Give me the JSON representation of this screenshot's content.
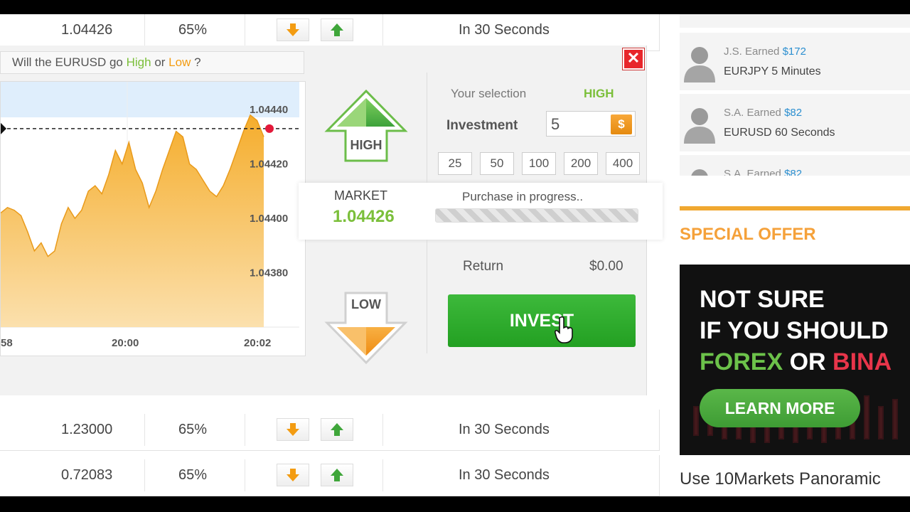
{
  "rows": {
    "top": {
      "rate": "1.04426",
      "payout": "65%",
      "expiry": "In 30 Seconds"
    },
    "row2": {
      "rate": "1.23000",
      "payout": "65%",
      "expiry": "In 30 Seconds"
    },
    "row3": {
      "rate": "0.72083",
      "payout": "65%",
      "expiry": "In 30 Seconds"
    }
  },
  "panel": {
    "question_prefix": "Will the EURUSD go",
    "question_high": "High",
    "question_or": "or",
    "question_low": "Low",
    "question_suffix": "?",
    "high_label": "HIGH",
    "low_label": "LOW",
    "market_label": "MARKET",
    "market_value": "1.04426",
    "purchase_status": "Purchase in progress..",
    "selection_label": "Your selection",
    "selection_value": "HIGH",
    "investment_label": "Investment",
    "investment_value": "5",
    "currency_symbol": "$",
    "amounts": [
      "25",
      "50",
      "100",
      "200",
      "400"
    ],
    "return_label": "Return",
    "return_value": "$0.00",
    "invest_label": "INVEST",
    "close_label": "✕"
  },
  "chart_data": {
    "type": "area",
    "x_tick_labels": [
      "58",
      "20:00",
      "20:02"
    ],
    "y_tick_labels": [
      "1.04440",
      "1.04420",
      "1.04400",
      "1.04380"
    ],
    "ylim": [
      1.0436,
      1.04445
    ],
    "values": [
      1.04402,
      1.04404,
      1.04403,
      1.04401,
      1.04395,
      1.04388,
      1.04391,
      1.04386,
      1.04388,
      1.04398,
      1.04404,
      1.044,
      1.04403,
      1.0441,
      1.04412,
      1.04409,
      1.04416,
      1.04425,
      1.0442,
      1.04428,
      1.04418,
      1.04413,
      1.04404,
      1.0441,
      1.04418,
      1.04425,
      1.04432,
      1.0443,
      1.0442,
      1.04418,
      1.04414,
      1.0441,
      1.04408,
      1.04412,
      1.04418,
      1.04425,
      1.04432,
      1.04438,
      1.04436,
      1.0443
    ],
    "current_level": 1.04433,
    "fill_color": "#f7b33e",
    "marker_color": "#e3193a"
  },
  "sidebar": {
    "feed": [
      {
        "who": "J.S. Earned",
        "amount": "$172",
        "what": "EURJPY 5 Minutes"
      },
      {
        "who": "S.A. Earned",
        "amount": "$82",
        "what": "EURUSD 60 Seconds"
      },
      {
        "who": "S.A. Earned",
        "amount": "$82",
        "what": ""
      }
    ],
    "special_offer": "SPECIAL OFFER",
    "banner": {
      "line1": "NOT SURE",
      "line2": "IF YOU SHOULD",
      "line3_a": "FOREX",
      "line3_b": "OR",
      "line3_c": "BINA",
      "button": "LEARN MORE"
    },
    "promo_text": "Use 10Markets Panoramic"
  }
}
